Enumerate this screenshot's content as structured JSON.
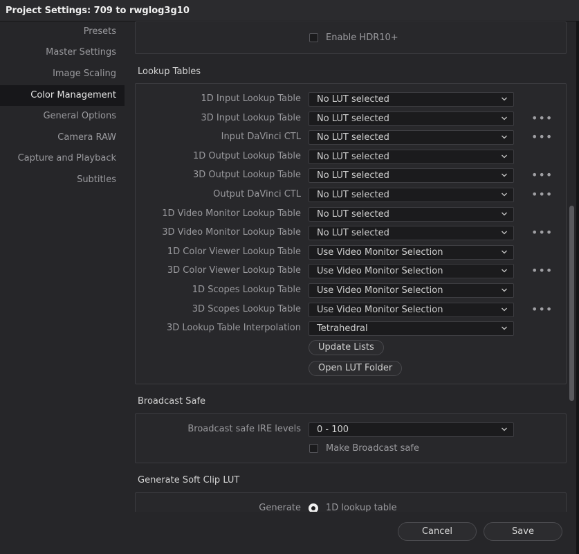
{
  "window": {
    "title": "Project Settings:  709 to rwglog3g10"
  },
  "sidebar": {
    "items": [
      {
        "label": "Presets"
      },
      {
        "label": "Master Settings"
      },
      {
        "label": "Image Scaling"
      },
      {
        "label": "Color Management"
      },
      {
        "label": "General Options"
      },
      {
        "label": "Camera RAW"
      },
      {
        "label": "Capture and Playback"
      },
      {
        "label": "Subtitles"
      }
    ],
    "active": "Color Management"
  },
  "hdr": {
    "enable_hdr10_label": "Enable HDR10+"
  },
  "lookup_tables": {
    "title": "Lookup Tables",
    "rows": [
      {
        "label": "1D Input Lookup Table",
        "value": "No LUT selected",
        "more": false
      },
      {
        "label": "3D Input Lookup Table",
        "value": "No LUT selected",
        "more": true
      },
      {
        "label": "Input DaVinci CTL",
        "value": "No LUT selected",
        "more": true
      },
      {
        "label": "1D Output Lookup Table",
        "value": "No LUT selected",
        "more": false
      },
      {
        "label": "3D Output Lookup Table",
        "value": "No LUT selected",
        "more": true
      },
      {
        "label": "Output DaVinci CTL",
        "value": "No LUT selected",
        "more": true
      },
      {
        "label": "1D Video Monitor Lookup Table",
        "value": "No LUT selected",
        "more": false
      },
      {
        "label": "3D Video Monitor Lookup Table",
        "value": "No LUT selected",
        "more": true
      },
      {
        "label": "1D Color Viewer Lookup Table",
        "value": "Use Video Monitor Selection",
        "more": false
      },
      {
        "label": "3D Color Viewer Lookup Table",
        "value": "Use Video Monitor Selection",
        "more": true
      },
      {
        "label": "1D Scopes Lookup Table",
        "value": "Use Video Monitor Selection",
        "more": false
      },
      {
        "label": "3D Scopes Lookup Table",
        "value": "Use Video Monitor Selection",
        "more": true
      },
      {
        "label": "3D Lookup Table Interpolation",
        "value": "Tetrahedral",
        "more": false
      }
    ],
    "update_lists_label": "Update Lists",
    "open_lut_folder_label": "Open LUT Folder",
    "more_glyph": "•••"
  },
  "broadcast_safe": {
    "title": "Broadcast Safe",
    "ire_label": "Broadcast safe IRE levels",
    "ire_value": "0 - 100",
    "make_safe_label": "Make Broadcast safe"
  },
  "soft_clip": {
    "title": "Generate Soft Clip LUT",
    "generate_label": "Generate",
    "option_label": "1D lookup table"
  },
  "footer": {
    "cancel_label": "Cancel",
    "save_label": "Save"
  }
}
